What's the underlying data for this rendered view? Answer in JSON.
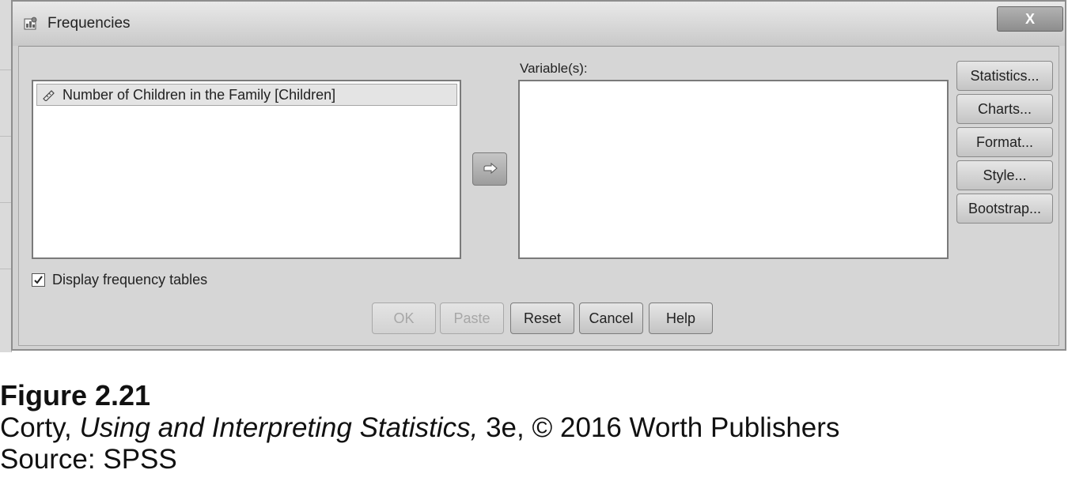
{
  "window": {
    "title": "Frequencies",
    "close_label": "X",
    "icon": "frequencies-window-icon"
  },
  "source_list": {
    "items": [
      {
        "label": "Number of Children in the Family [Children]",
        "icon": "scale-ruler-icon"
      }
    ]
  },
  "target_list": {
    "label": "Variable(s):",
    "items": []
  },
  "move_button": {
    "icon": "arrow-right-icon"
  },
  "side_buttons": {
    "statistics": "Statistics...",
    "charts": "Charts...",
    "format": "Format...",
    "style": "Style...",
    "bootstrap": "Bootstrap..."
  },
  "checkbox": {
    "label": "Display frequency tables",
    "checked": true
  },
  "bottom_buttons": {
    "ok": "OK",
    "paste": "Paste",
    "reset": "Reset",
    "cancel": "Cancel",
    "help": "Help"
  },
  "caption": {
    "figure": "Figure 2.21",
    "credit_prefix": "Corty, ",
    "credit_title": "Using and Interpreting Statistics,",
    "credit_suffix": " 3e, © 2016 Worth Publishers",
    "source": "Source: SPSS"
  },
  "colors": {
    "dialog_bg": "#d2d2d2",
    "list_bg": "#ffffff",
    "disabled_text": "#a7a7a7"
  }
}
